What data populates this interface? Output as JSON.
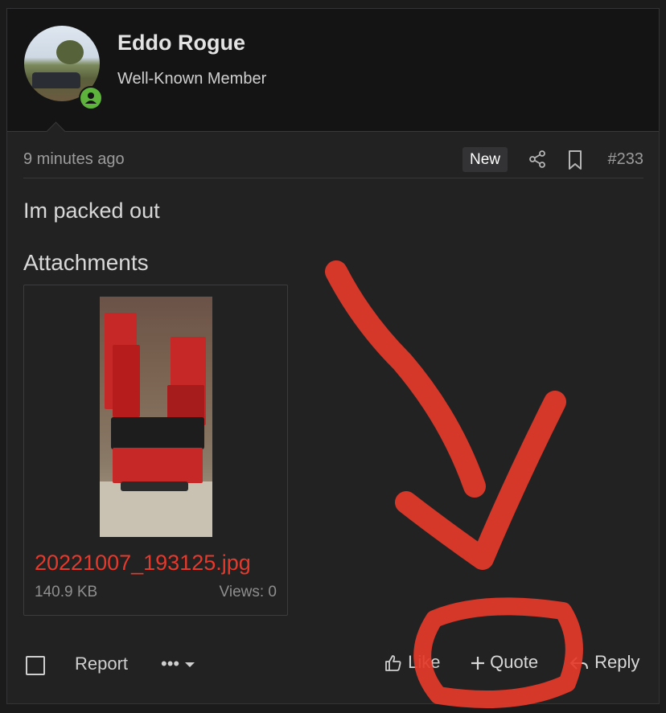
{
  "user": {
    "name": "Eddo Rogue",
    "title": "Well-Known Member",
    "status": "online"
  },
  "post": {
    "timestamp": "9 minutes ago",
    "badge": "New",
    "number": "#233",
    "body": "Im packed out"
  },
  "attachments": {
    "heading": "Attachments",
    "items": [
      {
        "file_name": "20221007_193125.jpg",
        "size": "140.9 KB",
        "views": "Views: 0"
      }
    ]
  },
  "actions": {
    "report": "Report",
    "more": "•••",
    "like": "Like",
    "quote": "Quote",
    "reply": "Reply"
  },
  "colors": {
    "accent": "#e5392c",
    "online": "#5db33b",
    "annotation": "#e53a2a"
  },
  "icons": [
    "share-icon",
    "bookmark-icon",
    "thumbs-up-icon",
    "plus-icon",
    "reply-icon",
    "chevron-down-icon"
  ]
}
